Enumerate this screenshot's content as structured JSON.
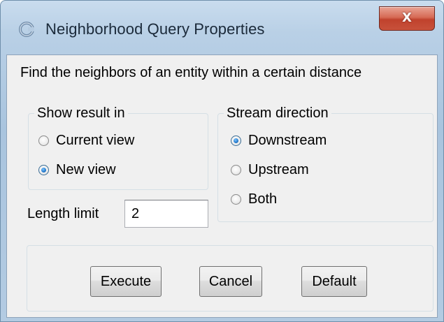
{
  "window": {
    "title": "Neighborhood Query Properties",
    "close_glyph": "X",
    "app_icon": "app-logo-icon"
  },
  "description": "Find the neighbors of an entity within a certain distance",
  "show_result": {
    "legend": "Show result in",
    "options": [
      {
        "label": "Current view",
        "selected": false
      },
      {
        "label": "New view",
        "selected": true
      }
    ]
  },
  "stream_direction": {
    "legend": "Stream direction",
    "options": [
      {
        "label": "Downstream",
        "selected": true
      },
      {
        "label": "Upstream",
        "selected": false
      },
      {
        "label": "Both",
        "selected": false
      }
    ]
  },
  "length_limit": {
    "label": "Length limit",
    "value": "2"
  },
  "buttons": {
    "execute": "Execute",
    "cancel": "Cancel",
    "default": "Default"
  },
  "colors": {
    "titlebar": "#b9d0e6",
    "close_button": "#c8513b",
    "client_background": "#f0f0f0",
    "radio_selected": "#2a7fd0"
  }
}
